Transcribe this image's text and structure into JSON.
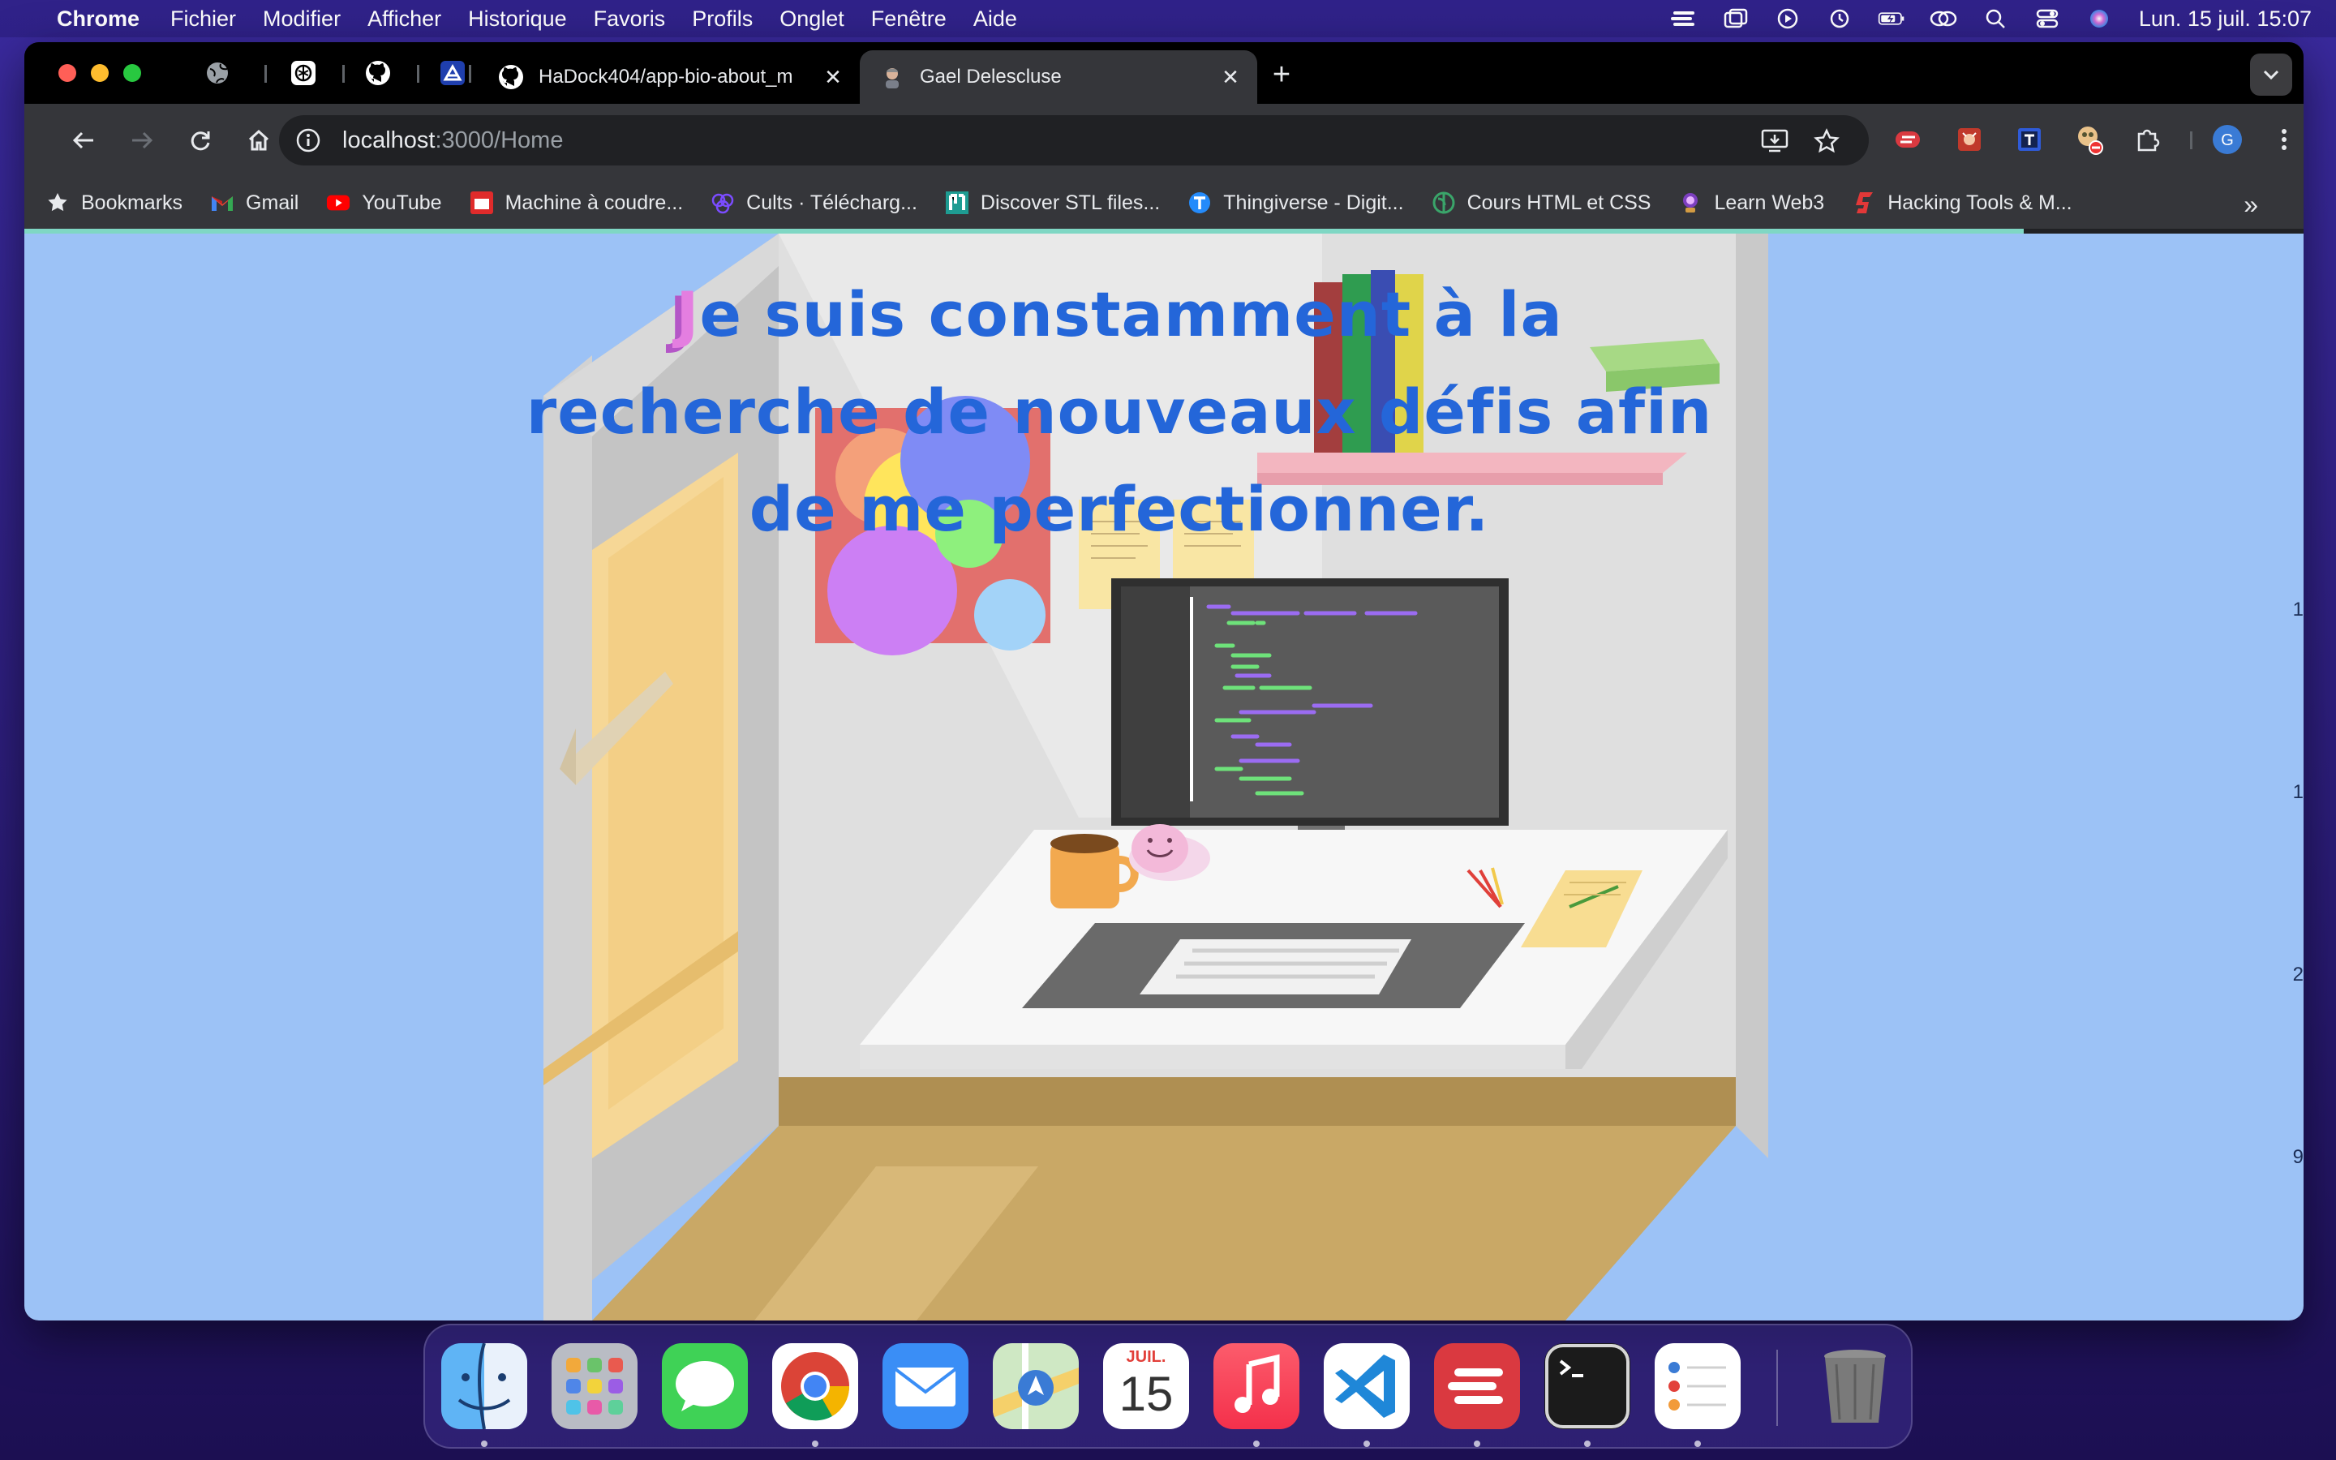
{
  "menubar": {
    "app": "Chrome",
    "items": [
      "Fichier",
      "Modifier",
      "Afficher",
      "Historique",
      "Favoris",
      "Profils",
      "Onglet",
      "Fenêtre",
      "Aide"
    ],
    "clock": "Lun. 15 juil.  15:07"
  },
  "tabs": {
    "inactive_title": "HaDock404/app-bio-about_m",
    "active_title": "Gael Delescluse",
    "close_glyph": "✕",
    "new_tab_glyph": "+"
  },
  "omnibox": {
    "host": "localhost",
    "path": ":3000/Home"
  },
  "bookmarks": [
    {
      "label": "Bookmarks",
      "icon": "star-icon"
    },
    {
      "label": "Gmail",
      "icon": "gmail-icon"
    },
    {
      "label": "YouTube",
      "icon": "youtube-icon"
    },
    {
      "label": "Machine à coudre...",
      "icon": "sewing-icon"
    },
    {
      "label": "Cults  ·  Télécharg...",
      "icon": "cults-icon"
    },
    {
      "label": "Discover STL files...",
      "icon": "stl-icon"
    },
    {
      "label": "Thingiverse - Digit...",
      "icon": "thingiverse-icon"
    },
    {
      "label": "Cours HTML et CSS",
      "icon": "course-icon"
    },
    {
      "label": "Learn Web3",
      "icon": "web3-icon"
    },
    {
      "label": "Hacking Tools & M...",
      "icon": "hacking-icon"
    }
  ],
  "bookmarks_more": "»",
  "page": {
    "headline_first_letter": "J",
    "headline_rest": "e suis constamment à la recherche de nouveaux défis afin de me perfectionner.",
    "edge_digits": [
      "1",
      "1",
      "2",
      "9"
    ]
  },
  "dock": {
    "calendar_month": "JUIL.",
    "calendar_day": "15",
    "apps": [
      "finder",
      "launchpad",
      "messages",
      "chrome",
      "mail",
      "maps",
      "calendar",
      "music",
      "vscode",
      "expressvpn",
      "terminal",
      "reminders",
      "trash"
    ]
  },
  "colors": {
    "page_background": "#9cc2f6",
    "headline": "#2466d9",
    "headline_accent": "#e47ee0",
    "tab_active": "#35363a",
    "loading_bar": "#7fd7c4"
  }
}
